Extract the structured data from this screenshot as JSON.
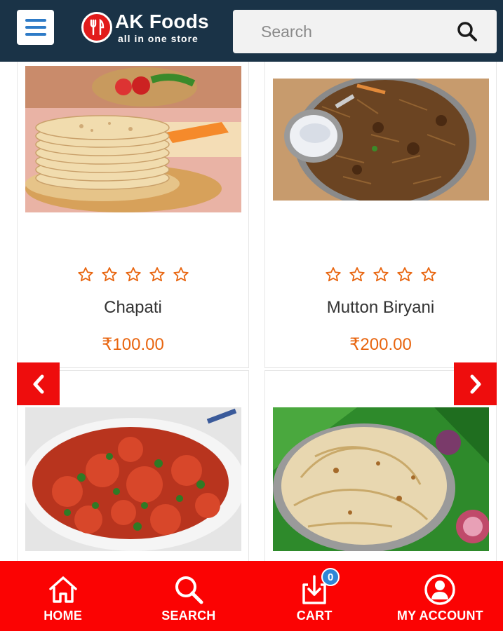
{
  "header": {
    "menu_icon": "hamburger-icon",
    "logo": {
      "title": "AK Foods",
      "tagline": "all in one store",
      "icon": "fork-knife-icon"
    },
    "search": {
      "placeholder": "Search",
      "icon": "search-icon"
    }
  },
  "products": [
    {
      "name": "Chapati",
      "price": "₹100.00",
      "rating": 0,
      "max_rating": 5
    },
    {
      "name": "Mutton Biryani",
      "price": "₹200.00",
      "rating": 0,
      "max_rating": 5
    },
    {
      "name": "",
      "price": "",
      "rating": 0,
      "max_rating": 5
    },
    {
      "name": "",
      "price": "",
      "rating": 0,
      "max_rating": 5
    }
  ],
  "carousel": {
    "prev_icon": "chevron-left-icon",
    "next_icon": "chevron-right-icon"
  },
  "bottom_nav": {
    "items": [
      {
        "label": "HOME",
        "icon": "home-icon"
      },
      {
        "label": "SEARCH",
        "icon": "search-icon"
      },
      {
        "label": "CART",
        "icon": "cart-download-icon",
        "badge": "0"
      },
      {
        "label": "MY ACCOUNT",
        "icon": "user-icon"
      }
    ]
  },
  "colors": {
    "header_bg": "#1a3347",
    "accent_red": "#fb0303",
    "price_orange": "#e8650f",
    "badge_blue": "#2e86d6"
  }
}
